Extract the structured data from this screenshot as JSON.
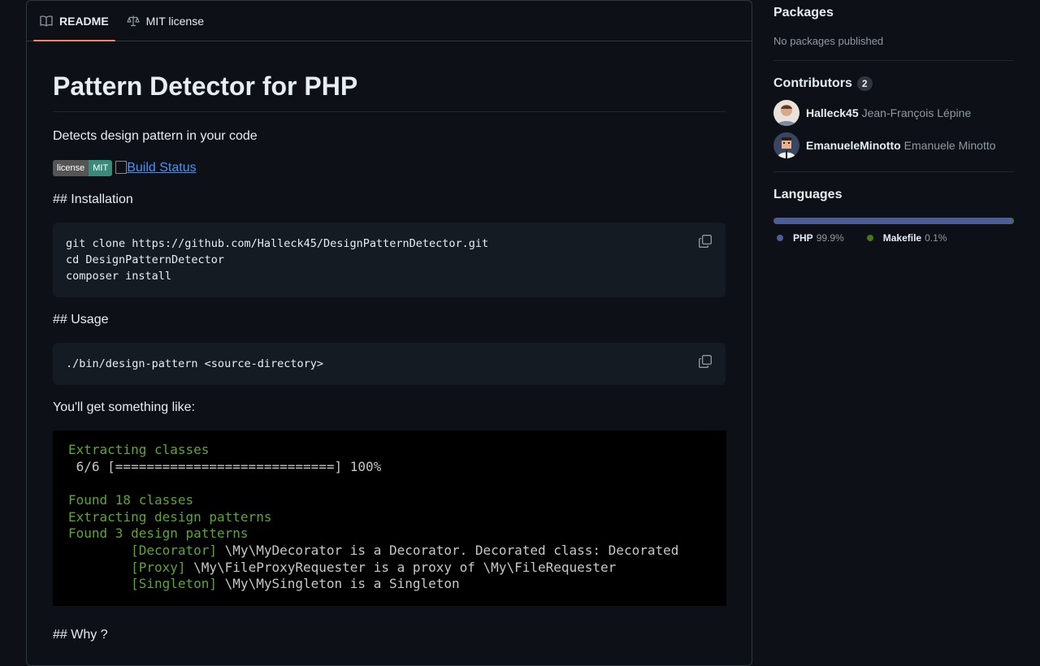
{
  "tabs": [
    {
      "label": "README",
      "icon": "book-icon",
      "active": true
    },
    {
      "label": "MIT license",
      "icon": "scale-icon",
      "active": false
    }
  ],
  "readme": {
    "title": "Pattern Detector for PHP",
    "description": "Detects design pattern in your code",
    "badge_license": {
      "left": "license",
      "right": "MIT"
    },
    "build_status_alt": "Build Status",
    "installation_heading": "## Installation",
    "install_code": "git clone https://github.com/Halleck45/DesignPatternDetector.git\ncd DesignPatternDetector\ncomposer install",
    "usage_heading": "## Usage",
    "usage_code": "./bin/design-pattern <source-directory>",
    "output_intro": "You'll get something like:",
    "terminal": {
      "line1": "Extracting classes",
      "line2": " 6/6 [============================] 100%",
      "line3": "Found 18 classes",
      "line4": "Extracting design patterns",
      "line5": "Found 3 design patterns",
      "p1_tag": "[Decorator]",
      "p1_text": " \\My\\MyDecorator is a Decorator. Decorated class: Decorated",
      "p2_tag": "[Proxy]",
      "p2_text": " \\My\\FileProxyRequester is a proxy of \\My\\FileRequester",
      "p3_tag": "[Singleton]",
      "p3_text": " \\My\\MySingleton is a Singleton"
    },
    "why_heading": "## Why ?"
  },
  "sidebar": {
    "packages": {
      "title": "Packages",
      "empty": "No packages published"
    },
    "contributors": {
      "title": "Contributors",
      "count": "2",
      "items": [
        {
          "login": "Halleck45",
          "name": "Jean-François Lépine"
        },
        {
          "login": "EmanueleMinotto",
          "name": "Emanuele Minotto"
        }
      ]
    },
    "languages": {
      "title": "Languages",
      "items": [
        {
          "name": "PHP",
          "percent": "99.9%",
          "color": "#4F5D95",
          "fraction": 0.999
        },
        {
          "name": "Makefile",
          "percent": "0.1%",
          "color": "#427819",
          "fraction": 0.001
        }
      ]
    }
  }
}
